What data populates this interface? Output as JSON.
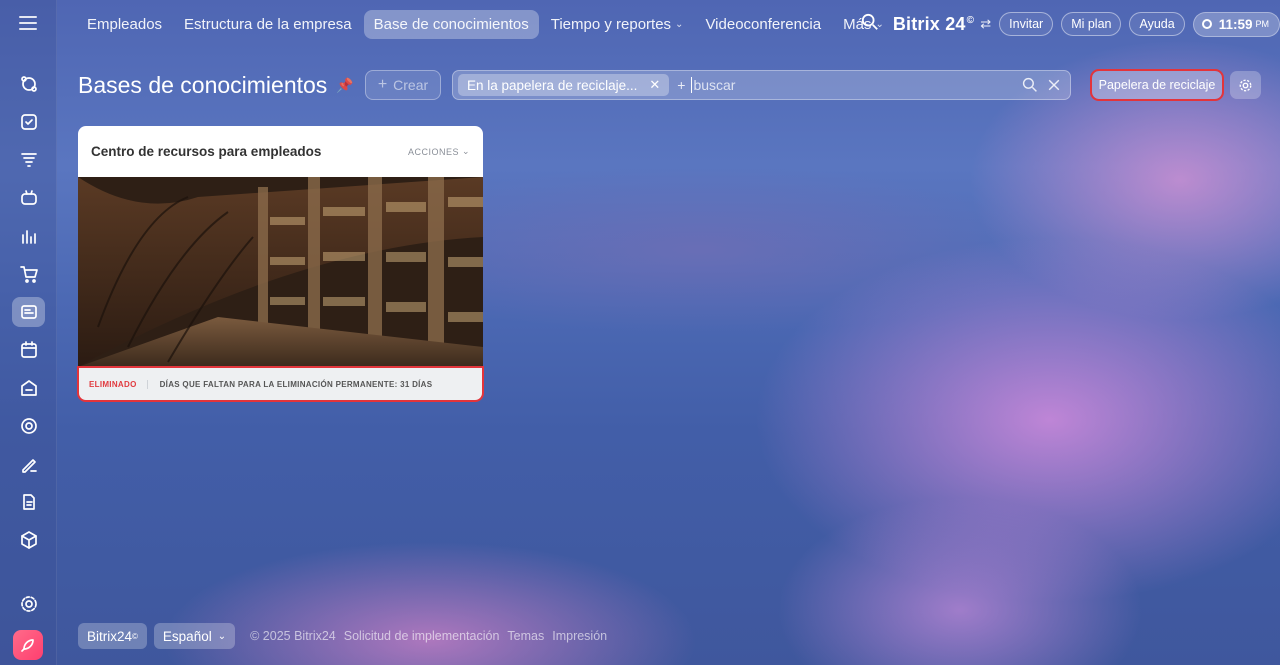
{
  "topnav": {
    "items": [
      {
        "label": "Empleados"
      },
      {
        "label": "Estructura de la empresa"
      },
      {
        "label": "Base de conocimientos"
      },
      {
        "label": "Tiempo y reportes"
      },
      {
        "label": "Videoconferencia"
      },
      {
        "label": "Más"
      }
    ],
    "brand": "Bitrix 24",
    "brand_badge": "©",
    "invite": "Invitar",
    "my_plan": "Mi plan",
    "help": "Ayuda",
    "time": "11:59",
    "time_suffix": "PM"
  },
  "page": {
    "title": "Bases de conocimientos",
    "create_label": "Crear",
    "filter_tag": "En la papelera de reciclaje...",
    "filter_plus": "+",
    "search_placeholder": "buscar",
    "trash_button": "Papelera de reciclaje"
  },
  "card": {
    "title": "Centro de recursos para empleados",
    "actions": "ACCIONES",
    "status": "ELIMINADO",
    "days_text": "DÍAS QUE FALTAN PARA LA ELIMINACIÓN PERMANENTE: 31 DÍAS"
  },
  "footer": {
    "brand": "Bitrix24",
    "language": "Español",
    "links": [
      "© 2025 Bitrix24",
      "Solicitud de implementación",
      "Temas",
      "Impresión"
    ]
  },
  "colors": {
    "highlight": "#e3343b",
    "deleted": "#e13a3f"
  }
}
